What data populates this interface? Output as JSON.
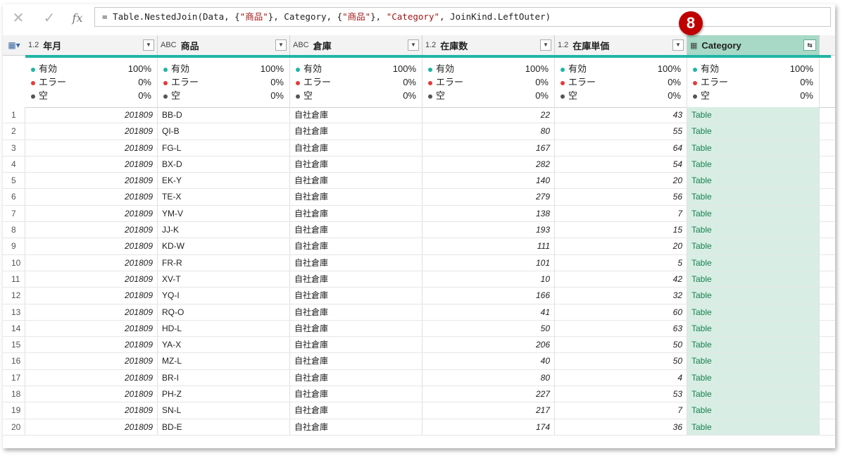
{
  "formula_bar": {
    "cancel_icon": "close-icon",
    "commit_icon": "check-icon",
    "fx_label": "fx",
    "formula_parts": [
      {
        "text": "= Table.NestedJoin(Data, {",
        "kind": "plain"
      },
      {
        "text": "\"商品\"",
        "kind": "str"
      },
      {
        "text": "}, Category, {",
        "kind": "plain"
      },
      {
        "text": "\"商品\"",
        "kind": "str"
      },
      {
        "text": "}, ",
        "kind": "plain"
      },
      {
        "text": "\"Category\"",
        "kind": "str"
      },
      {
        "text": ", JoinKind.LeftOuter)",
        "kind": "plain"
      }
    ]
  },
  "badge": {
    "label": "8",
    "color": "#c00000"
  },
  "columns": [
    {
      "type_label": "1.2",
      "name": "年月"
    },
    {
      "type_label": "ABC",
      "name": "商品"
    },
    {
      "type_label": "ABC",
      "name": "倉庫"
    },
    {
      "type_label": "1.2",
      "name": "在庫数"
    },
    {
      "type_label": "1.2",
      "name": "在庫単価"
    },
    {
      "type_label": "table",
      "name": "Category"
    }
  ],
  "stats": {
    "valid_label": "有効",
    "valid_pct": "100%",
    "error_label": "エラー",
    "error_pct": "0%",
    "empty_label": "空",
    "empty_pct": "0%"
  },
  "rows": [
    {
      "n": "1",
      "ym": "201809",
      "sh": "BB-D",
      "wh": "自社倉庫",
      "qty": "22",
      "up": "43",
      "cat": "Table"
    },
    {
      "n": "2",
      "ym": "201809",
      "sh": "QI-B",
      "wh": "自社倉庫",
      "qty": "80",
      "up": "55",
      "cat": "Table"
    },
    {
      "n": "3",
      "ym": "201809",
      "sh": "FG-L",
      "wh": "自社倉庫",
      "qty": "167",
      "up": "64",
      "cat": "Table"
    },
    {
      "n": "4",
      "ym": "201809",
      "sh": "BX-D",
      "wh": "自社倉庫",
      "qty": "282",
      "up": "54",
      "cat": "Table"
    },
    {
      "n": "5",
      "ym": "201809",
      "sh": "EK-Y",
      "wh": "自社倉庫",
      "qty": "140",
      "up": "20",
      "cat": "Table"
    },
    {
      "n": "6",
      "ym": "201809",
      "sh": "TE-X",
      "wh": "自社倉庫",
      "qty": "279",
      "up": "56",
      "cat": "Table"
    },
    {
      "n": "7",
      "ym": "201809",
      "sh": "YM-V",
      "wh": "自社倉庫",
      "qty": "138",
      "up": "7",
      "cat": "Table"
    },
    {
      "n": "8",
      "ym": "201809",
      "sh": "JJ-K",
      "wh": "自社倉庫",
      "qty": "193",
      "up": "15",
      "cat": "Table"
    },
    {
      "n": "9",
      "ym": "201809",
      "sh": "KD-W",
      "wh": "自社倉庫",
      "qty": "111",
      "up": "20",
      "cat": "Table"
    },
    {
      "n": "10",
      "ym": "201809",
      "sh": "FR-R",
      "wh": "自社倉庫",
      "qty": "101",
      "up": "5",
      "cat": "Table"
    },
    {
      "n": "11",
      "ym": "201809",
      "sh": "XV-T",
      "wh": "自社倉庫",
      "qty": "10",
      "up": "42",
      "cat": "Table"
    },
    {
      "n": "12",
      "ym": "201809",
      "sh": "YQ-I",
      "wh": "自社倉庫",
      "qty": "166",
      "up": "32",
      "cat": "Table"
    },
    {
      "n": "13",
      "ym": "201809",
      "sh": "RQ-O",
      "wh": "自社倉庫",
      "qty": "41",
      "up": "60",
      "cat": "Table"
    },
    {
      "n": "14",
      "ym": "201809",
      "sh": "HD-L",
      "wh": "自社倉庫",
      "qty": "50",
      "up": "63",
      "cat": "Table"
    },
    {
      "n": "15",
      "ym": "201809",
      "sh": "YA-X",
      "wh": "自社倉庫",
      "qty": "206",
      "up": "50",
      "cat": "Table"
    },
    {
      "n": "16",
      "ym": "201809",
      "sh": "MZ-L",
      "wh": "自社倉庫",
      "qty": "40",
      "up": "50",
      "cat": "Table"
    },
    {
      "n": "17",
      "ym": "201809",
      "sh": "BR-I",
      "wh": "自社倉庫",
      "qty": "80",
      "up": "4",
      "cat": "Table"
    },
    {
      "n": "18",
      "ym": "201809",
      "sh": "PH-Z",
      "wh": "自社倉庫",
      "qty": "227",
      "up": "53",
      "cat": "Table"
    },
    {
      "n": "19",
      "ym": "201809",
      "sh": "SN-L",
      "wh": "自社倉庫",
      "qty": "217",
      "up": "7",
      "cat": "Table"
    },
    {
      "n": "20",
      "ym": "201809",
      "sh": "BD-E",
      "wh": "自社倉庫",
      "qty": "174",
      "up": "36",
      "cat": "Table"
    }
  ]
}
